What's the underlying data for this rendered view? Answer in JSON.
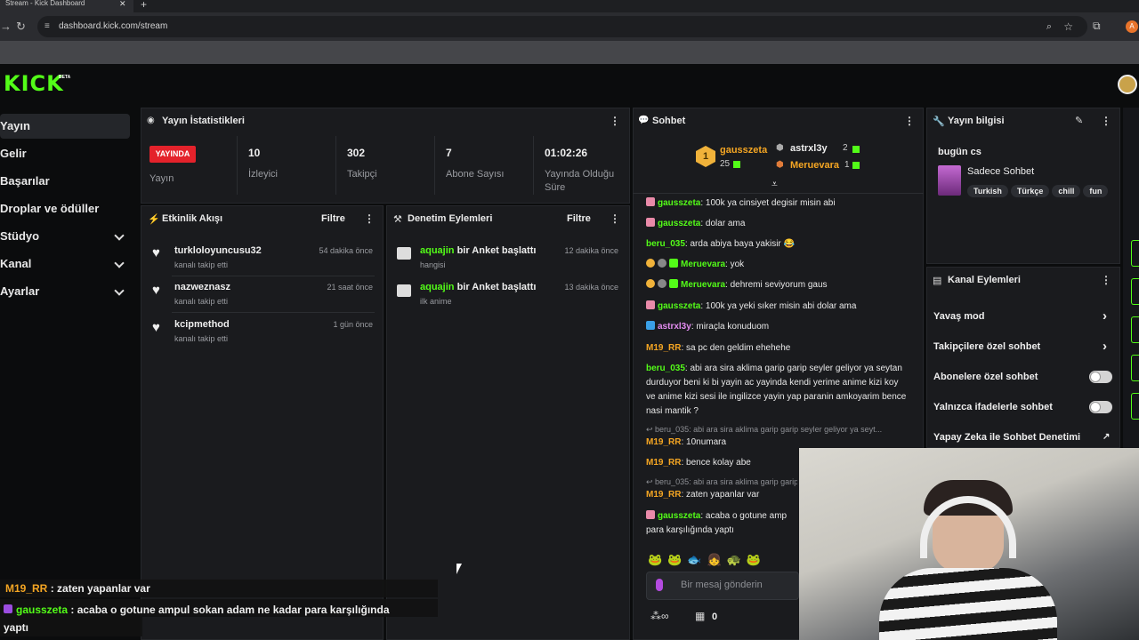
{
  "browser": {
    "tab_title": "Stream - Kick Dashboard",
    "url": "dashboard.kick.com/stream"
  },
  "header": {
    "logo": "KICK",
    "beta": "BETA"
  },
  "sidebar": {
    "items": [
      {
        "label": "Yayın",
        "active": true,
        "expandable": false
      },
      {
        "label": "Gelir",
        "active": false,
        "expandable": false
      },
      {
        "label": "Başarılar",
        "active": false,
        "expandable": false
      },
      {
        "label": "Droplar ve ödüller",
        "active": false,
        "expandable": false
      },
      {
        "label": "Stüdyo",
        "active": false,
        "expandable": true
      },
      {
        "label": "Kanal",
        "active": false,
        "expandable": true
      },
      {
        "label": "Ayarlar",
        "active": false,
        "expandable": true
      }
    ]
  },
  "stats": {
    "title": "Yayın İstatistikleri",
    "live_label": "YAYINDA",
    "live_sub": "Yayın",
    "items": [
      {
        "value": "10",
        "label": "İzleyici"
      },
      {
        "value": "302",
        "label": "Takipçi"
      },
      {
        "value": "7",
        "label": "Abone Sayısı"
      },
      {
        "value": "01:02:26",
        "label": "Yayında Olduğu Süre"
      }
    ]
  },
  "activity": {
    "title": "Etkinlik Akışı",
    "filter": "Filtre",
    "items": [
      {
        "name": "turkloloyuncusu32",
        "sub": "kanalı takip etti",
        "time": "54 dakika önce"
      },
      {
        "name": "nazweznasz",
        "sub": "kanalı takip etti",
        "time": "21 saat önce"
      },
      {
        "name": "kcipmethod",
        "sub": "kanalı takip etti",
        "time": "1 gün önce"
      }
    ]
  },
  "moderation": {
    "title": "Denetim Eylemleri",
    "filter": "Filtre",
    "items": [
      {
        "user": "aquajin",
        "action": "bir Anket başlattı",
        "sub": "hangisi",
        "time": "12 dakika önce"
      },
      {
        "user": "aquajin",
        "action": "bir Anket başlattı",
        "sub": "ilk anime",
        "time": "13 dakika önce"
      }
    ]
  },
  "chat": {
    "title": "Sohbet",
    "leaders": {
      "first_name": "gausszeta",
      "first_count": "25",
      "second_name": "astrxl3y",
      "second_count": "2",
      "third_name": "Meruevara",
      "third_count": "1"
    },
    "messages": [
      {
        "user": "gausszeta",
        "text": "100k ya cinsiyet degisir misin abi"
      },
      {
        "user": "gausszeta",
        "text": "dolar ama"
      },
      {
        "user": "beru_035",
        "text": "arda abiya baya yakisir 😂"
      },
      {
        "user": "Meruevara",
        "text": "yok"
      },
      {
        "user": "Meruevara",
        "text": "dehremi seviyorum gaus"
      },
      {
        "user": "gausszeta",
        "text": "100k ya yeki sıker misin abi dolar ama"
      },
      {
        "user": "astrxl3y",
        "text": "miraçla konuduom"
      },
      {
        "user": "M19_RR",
        "text": "sa pc den geldim ehehehe"
      },
      {
        "user": "beru_035",
        "text": "abi ara sira aklima garip garip seyler geliyor ya seytan durduyor beni ki bi yayin ac yayinda kendi yerime anime kizi koy ve anime kizi sesi ile ingilizce yayin yap paranin amkoyarim bence nasi mantik ?"
      },
      {
        "reply": "beru_035: abi ara sira aklima garip garip seyler geliyor ya seyt...",
        "user": "M19_RR",
        "text": "10numara"
      },
      {
        "user": "M19_RR",
        "text": "bence kolay abe"
      },
      {
        "reply": "beru_035: abi ara sira aklima garip garip",
        "user": "M19_RR",
        "text": "zaten yapanlar var"
      },
      {
        "user": "gausszeta",
        "text": "acaba o gotune amp",
        "text2": "para karşılığında yaptı"
      }
    ],
    "input_placeholder": "Bir mesaj gönderin",
    "points": "0"
  },
  "info": {
    "title": "Yayın bilgisi",
    "stream_title": "bugün cs",
    "category": "Sadece Sohbet",
    "tags": [
      "Turkish",
      "Türkçe",
      "chill",
      "fun"
    ]
  },
  "channel_actions": {
    "title": "Kanal Eylemleri",
    "items": [
      {
        "label": "Yavaş mod",
        "control": "chevron"
      },
      {
        "label": "Takipçilere özel sohbet",
        "control": "chevron"
      },
      {
        "label": "Abonelere özel sohbet",
        "control": "toggle",
        "on": false
      },
      {
        "label": "Yalnızca ifadelerle sohbet",
        "control": "toggle",
        "on": false
      },
      {
        "label": "Yapay Zeka ile Sohbet Denetimi",
        "control": "external"
      }
    ]
  },
  "overlay": {
    "line1_user": "M19_RR",
    "line1_text": "zaten yapanlar var",
    "line2_user": "gausszeta",
    "line2_text": "acaba o gotune ampul sokan adam ne kadar para karşılığında",
    "line2_text2": "yaptı"
  },
  "colors": {
    "accent": "#53fc18",
    "live": "#e4222b",
    "panel": "#1a1b1e"
  }
}
